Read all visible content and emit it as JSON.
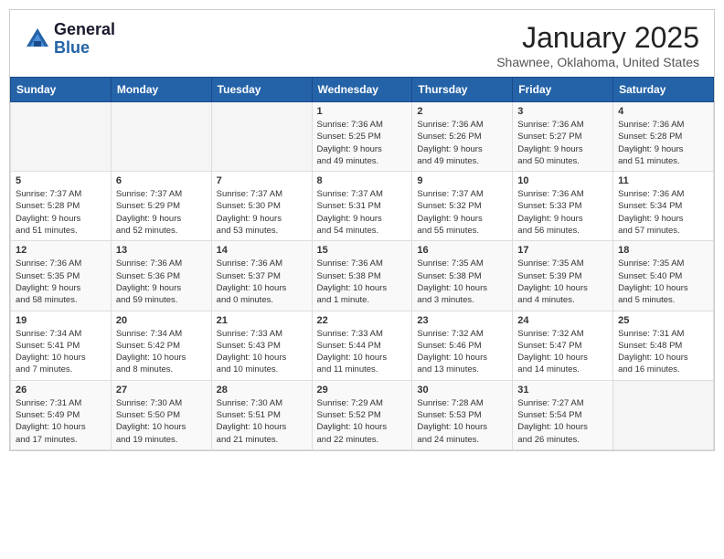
{
  "logo": {
    "general": "General",
    "blue": "Blue"
  },
  "header": {
    "title": "January 2025",
    "subtitle": "Shawnee, Oklahoma, United States"
  },
  "weekdays": [
    "Sunday",
    "Monday",
    "Tuesday",
    "Wednesday",
    "Thursday",
    "Friday",
    "Saturday"
  ],
  "weeks": [
    [
      {
        "day": "",
        "info": ""
      },
      {
        "day": "",
        "info": ""
      },
      {
        "day": "",
        "info": ""
      },
      {
        "day": "1",
        "info": "Sunrise: 7:36 AM\nSunset: 5:25 PM\nDaylight: 9 hours\nand 49 minutes."
      },
      {
        "day": "2",
        "info": "Sunrise: 7:36 AM\nSunset: 5:26 PM\nDaylight: 9 hours\nand 49 minutes."
      },
      {
        "day": "3",
        "info": "Sunrise: 7:36 AM\nSunset: 5:27 PM\nDaylight: 9 hours\nand 50 minutes."
      },
      {
        "day": "4",
        "info": "Sunrise: 7:36 AM\nSunset: 5:28 PM\nDaylight: 9 hours\nand 51 minutes."
      }
    ],
    [
      {
        "day": "5",
        "info": "Sunrise: 7:37 AM\nSunset: 5:28 PM\nDaylight: 9 hours\nand 51 minutes."
      },
      {
        "day": "6",
        "info": "Sunrise: 7:37 AM\nSunset: 5:29 PM\nDaylight: 9 hours\nand 52 minutes."
      },
      {
        "day": "7",
        "info": "Sunrise: 7:37 AM\nSunset: 5:30 PM\nDaylight: 9 hours\nand 53 minutes."
      },
      {
        "day": "8",
        "info": "Sunrise: 7:37 AM\nSunset: 5:31 PM\nDaylight: 9 hours\nand 54 minutes."
      },
      {
        "day": "9",
        "info": "Sunrise: 7:37 AM\nSunset: 5:32 PM\nDaylight: 9 hours\nand 55 minutes."
      },
      {
        "day": "10",
        "info": "Sunrise: 7:36 AM\nSunset: 5:33 PM\nDaylight: 9 hours\nand 56 minutes."
      },
      {
        "day": "11",
        "info": "Sunrise: 7:36 AM\nSunset: 5:34 PM\nDaylight: 9 hours\nand 57 minutes."
      }
    ],
    [
      {
        "day": "12",
        "info": "Sunrise: 7:36 AM\nSunset: 5:35 PM\nDaylight: 9 hours\nand 58 minutes."
      },
      {
        "day": "13",
        "info": "Sunrise: 7:36 AM\nSunset: 5:36 PM\nDaylight: 9 hours\nand 59 minutes."
      },
      {
        "day": "14",
        "info": "Sunrise: 7:36 AM\nSunset: 5:37 PM\nDaylight: 10 hours\nand 0 minutes."
      },
      {
        "day": "15",
        "info": "Sunrise: 7:36 AM\nSunset: 5:38 PM\nDaylight: 10 hours\nand 1 minute."
      },
      {
        "day": "16",
        "info": "Sunrise: 7:35 AM\nSunset: 5:38 PM\nDaylight: 10 hours\nand 3 minutes."
      },
      {
        "day": "17",
        "info": "Sunrise: 7:35 AM\nSunset: 5:39 PM\nDaylight: 10 hours\nand 4 minutes."
      },
      {
        "day": "18",
        "info": "Sunrise: 7:35 AM\nSunset: 5:40 PM\nDaylight: 10 hours\nand 5 minutes."
      }
    ],
    [
      {
        "day": "19",
        "info": "Sunrise: 7:34 AM\nSunset: 5:41 PM\nDaylight: 10 hours\nand 7 minutes."
      },
      {
        "day": "20",
        "info": "Sunrise: 7:34 AM\nSunset: 5:42 PM\nDaylight: 10 hours\nand 8 minutes."
      },
      {
        "day": "21",
        "info": "Sunrise: 7:33 AM\nSunset: 5:43 PM\nDaylight: 10 hours\nand 10 minutes."
      },
      {
        "day": "22",
        "info": "Sunrise: 7:33 AM\nSunset: 5:44 PM\nDaylight: 10 hours\nand 11 minutes."
      },
      {
        "day": "23",
        "info": "Sunrise: 7:32 AM\nSunset: 5:46 PM\nDaylight: 10 hours\nand 13 minutes."
      },
      {
        "day": "24",
        "info": "Sunrise: 7:32 AM\nSunset: 5:47 PM\nDaylight: 10 hours\nand 14 minutes."
      },
      {
        "day": "25",
        "info": "Sunrise: 7:31 AM\nSunset: 5:48 PM\nDaylight: 10 hours\nand 16 minutes."
      }
    ],
    [
      {
        "day": "26",
        "info": "Sunrise: 7:31 AM\nSunset: 5:49 PM\nDaylight: 10 hours\nand 17 minutes."
      },
      {
        "day": "27",
        "info": "Sunrise: 7:30 AM\nSunset: 5:50 PM\nDaylight: 10 hours\nand 19 minutes."
      },
      {
        "day": "28",
        "info": "Sunrise: 7:30 AM\nSunset: 5:51 PM\nDaylight: 10 hours\nand 21 minutes."
      },
      {
        "day": "29",
        "info": "Sunrise: 7:29 AM\nSunset: 5:52 PM\nDaylight: 10 hours\nand 22 minutes."
      },
      {
        "day": "30",
        "info": "Sunrise: 7:28 AM\nSunset: 5:53 PM\nDaylight: 10 hours\nand 24 minutes."
      },
      {
        "day": "31",
        "info": "Sunrise: 7:27 AM\nSunset: 5:54 PM\nDaylight: 10 hours\nand 26 minutes."
      },
      {
        "day": "",
        "info": ""
      }
    ]
  ]
}
